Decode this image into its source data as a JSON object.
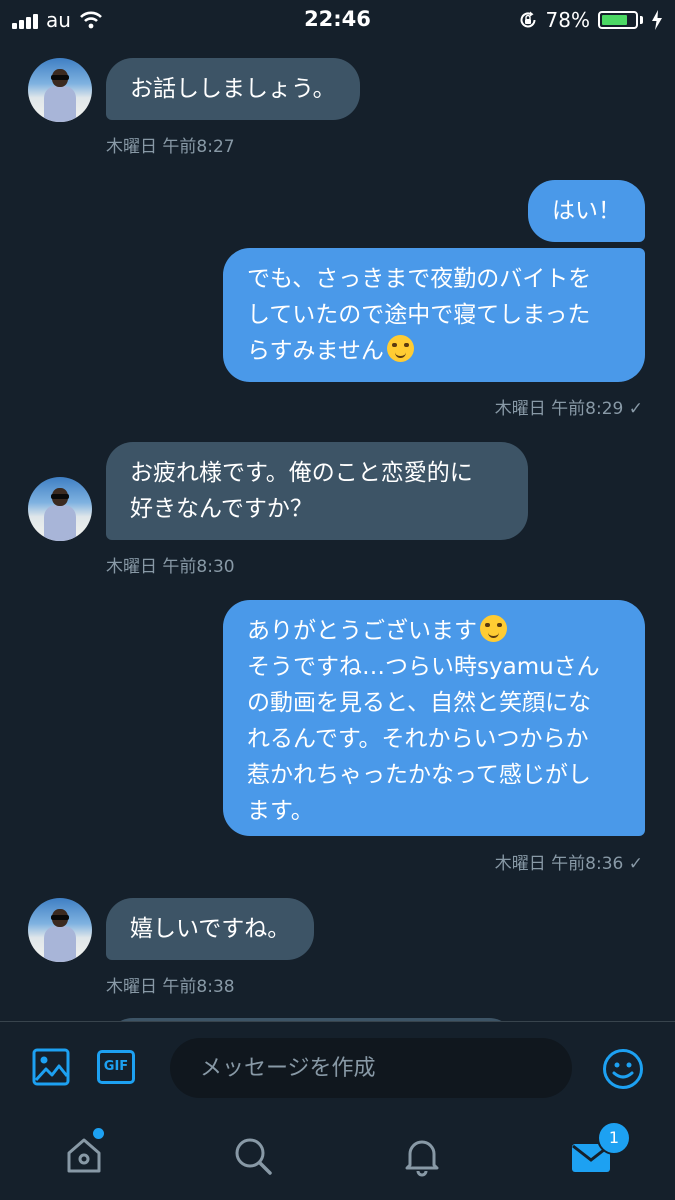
{
  "status_bar": {
    "carrier": "au",
    "time": "22:46",
    "battery_percent": "78%",
    "battery_level": 0.78
  },
  "messages": [
    {
      "direction": "in",
      "text": "お話ししましょう。",
      "timestamp": "木曜日 午前8:27"
    },
    {
      "direction": "out",
      "text": "はい！"
    },
    {
      "direction": "out",
      "lines": [
        "でも、さっきまで夜勤のバイトを",
        "していたので途中で寝てしまった",
        "らすみません"
      ],
      "emoji": "sweat-smile-emoji",
      "timestamp": "木曜日 午前8:29 ✓"
    },
    {
      "direction": "in",
      "lines": [
        "お疲れ様です。俺のこと恋愛的に",
        "好きなんですか？"
      ],
      "timestamp": "木曜日 午前8:30"
    },
    {
      "direction": "out",
      "lines": [
        "ありがとうございます",
        "そうですね…つらい時syamuさん",
        "の動画を見ると、自然と笑顔にな",
        "れるんです。それからいつからか",
        "惹かれちゃったかなって感じがし",
        "ます。"
      ],
      "emoji": "relieved-emoji",
      "timestamp": "木曜日 午前8:36 ✓"
    },
    {
      "direction": "in",
      "text": "嬉しいですね。",
      "timestamp": "木曜日 午前8:38"
    }
  ],
  "composer": {
    "placeholder": "メッセージを作成",
    "gif_label": "GIF"
  },
  "tab_bar": {
    "message_badge": "1"
  },
  "colors": {
    "background": "#15202b",
    "incoming_bubble": "#3d5466",
    "outgoing_bubble": "#4a99e9",
    "accent": "#1da1f2",
    "muted_text": "#8899a6"
  }
}
